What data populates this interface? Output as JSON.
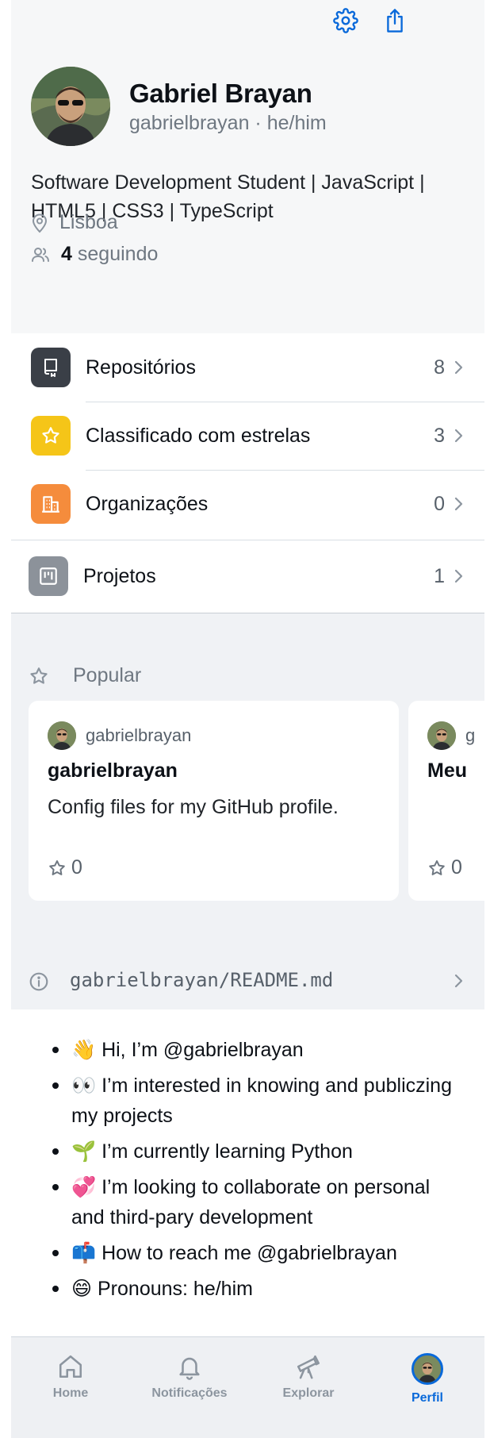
{
  "header": {
    "name": "Gabriel Brayan",
    "handle": "gabrielbrayan · he/him",
    "bio": "Software Development Student | JavaScript | HTML5 | CSS3 | TypeScript",
    "location": "Lisboa",
    "following_count": "4",
    "following_label": "seguindo",
    "settings_icon": "gear-icon",
    "share_icon": "share-icon"
  },
  "menu": [
    {
      "label": "Repositórios",
      "count": "8",
      "icon": "repo-icon",
      "color": "#3a3f47"
    },
    {
      "label": "Classificado com estrelas",
      "count": "3",
      "icon": "star-icon",
      "color": "#f5c518"
    },
    {
      "label": "Organizações",
      "count": "0",
      "icon": "organization-icon",
      "color": "#f58c3c"
    },
    {
      "label": "Projetos",
      "count": "1",
      "icon": "project-icon",
      "color": "#8c929a"
    }
  ],
  "popular": {
    "title": "Popular",
    "cards": [
      {
        "owner": "gabrielbrayan",
        "title": "gabrielbrayan",
        "description": "Config files for my GitHub profile.",
        "stars": "0"
      },
      {
        "owner": "g",
        "title": "Meu",
        "description": "",
        "stars": "0"
      }
    ]
  },
  "readme": {
    "title": "gabrielbrayan/README.md",
    "items": [
      "👋 Hi, I’m @gabrielbrayan",
      "👀 I’m interested in knowing and publiczing my projects",
      "🌱 I’m currently learning Python",
      "💞️ I’m looking to collaborate on personal and third-pary development",
      "📫 How to reach me @gabrielbrayan",
      "😄 Pronouns: he/him"
    ]
  },
  "tabs": [
    {
      "label": "Home",
      "icon": "home-icon"
    },
    {
      "label": "Notificações",
      "icon": "bell-icon"
    },
    {
      "label": "Explorar",
      "icon": "telescope-icon"
    },
    {
      "label": "Perfil",
      "icon": "avatar",
      "active": true
    }
  ],
  "colors": {
    "accent": "#0969da",
    "header_bg": "#f6f7f8",
    "section_bg": "#f0f2f5"
  }
}
